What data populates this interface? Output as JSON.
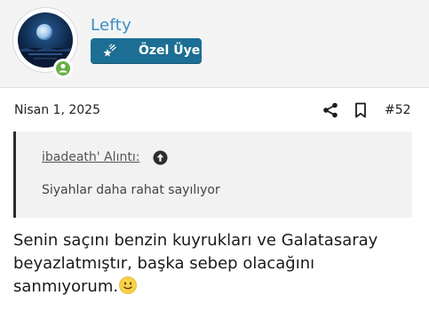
{
  "user": {
    "name": "Lefty",
    "badge_label": "Özel Üye",
    "badge_color": "#1c6e94",
    "status": "online"
  },
  "post": {
    "date": "Nisan 1, 2025",
    "number": "#52",
    "actions": [
      "share-icon",
      "bookmark-icon"
    ]
  },
  "quote": {
    "author_text": "ibadeath' Alıntı:",
    "text": "Siyahlar daha rahat sayılıyor"
  },
  "message": {
    "lines": [
      "Senin saçını benzin kuyrukları ve Galatasaray",
      "beyazlatmıştır, başka sebep olacağını",
      "sanmıyorum."
    ],
    "emoji": "slightly-smiling-face"
  }
}
